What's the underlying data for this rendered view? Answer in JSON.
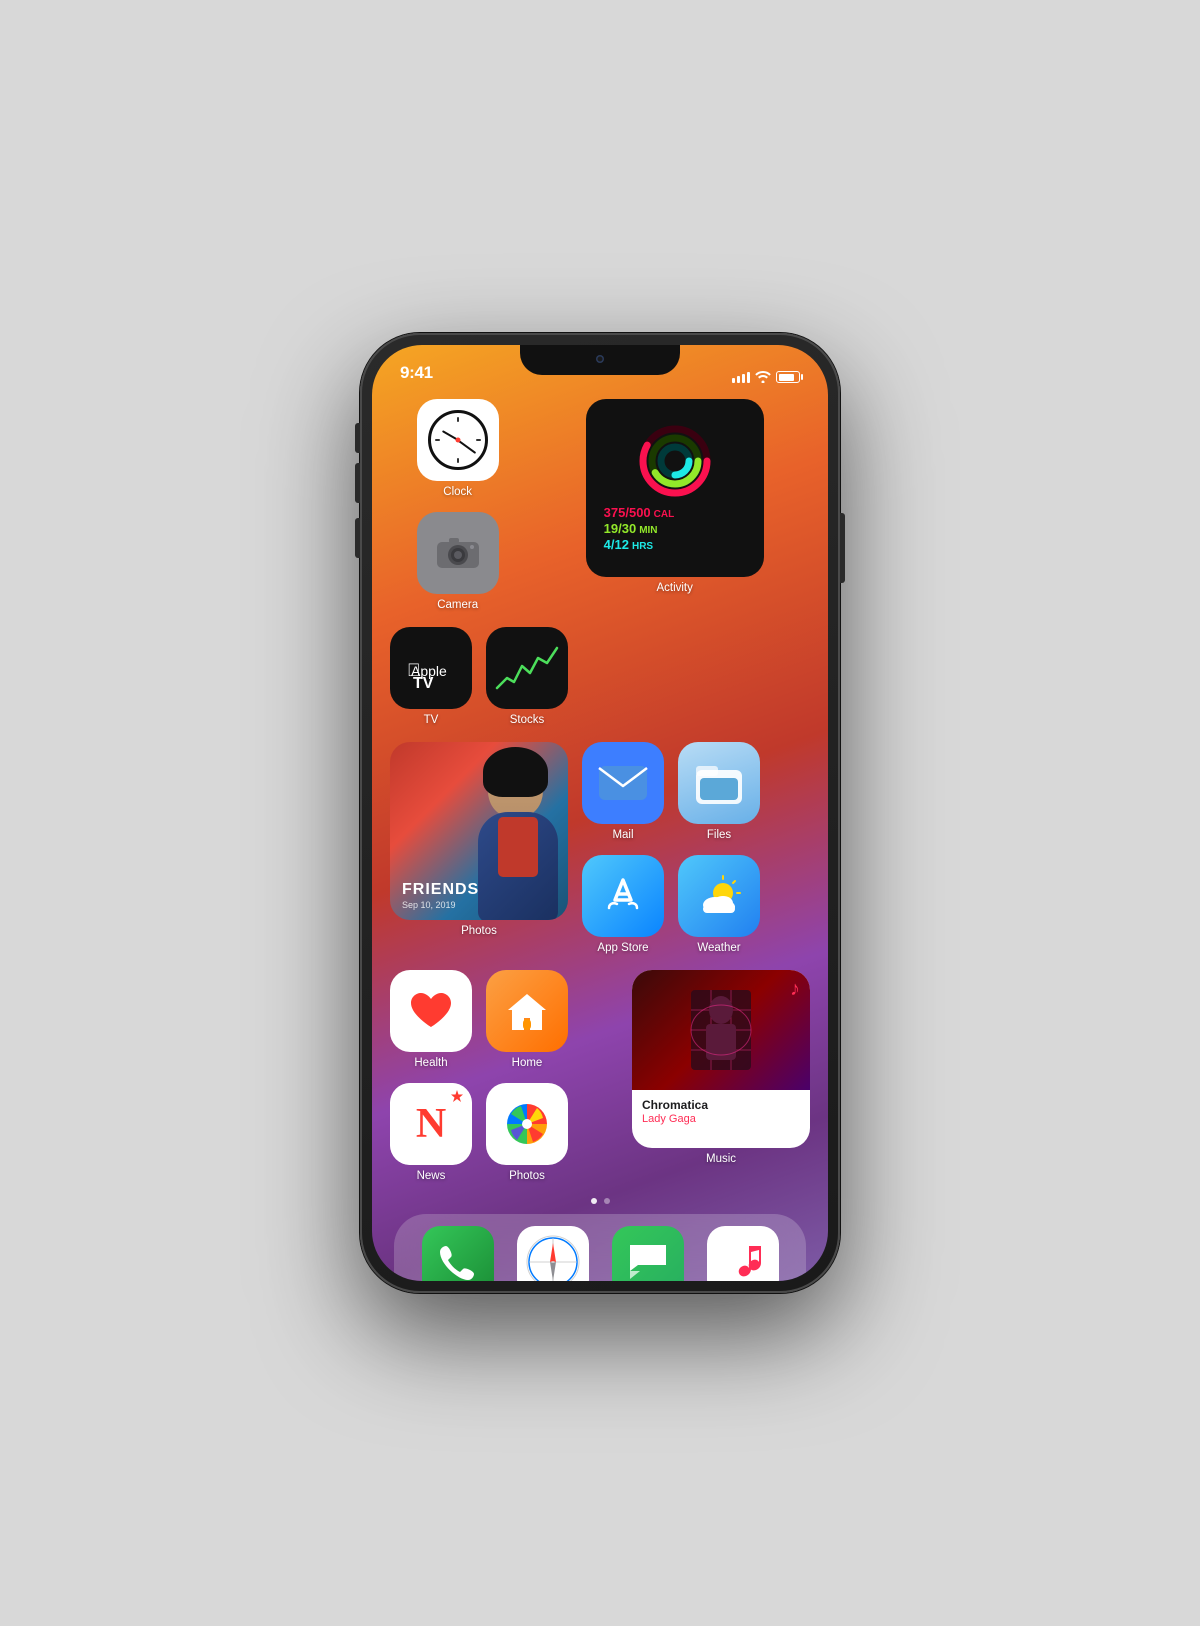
{
  "page": {
    "bg_color": "#d0d0d0"
  },
  "status_bar": {
    "time": "9:41",
    "signal_bars": [
      3,
      5,
      7,
      9,
      11
    ],
    "wifi": "wifi",
    "battery": 80
  },
  "row1": {
    "apps": [
      {
        "id": "clock",
        "label": "Clock"
      },
      {
        "id": "camera",
        "label": "Camera"
      }
    ],
    "widget": {
      "id": "activity",
      "label": "Activity",
      "stats": [
        {
          "value": "375/500",
          "unit": "CAL",
          "color": "#fa114f"
        },
        {
          "value": "19/30",
          "unit": "MIN",
          "color": "#92e82a"
        },
        {
          "value": "4/12",
          "unit": "HRS",
          "color": "#1de9e6"
        }
      ]
    }
  },
  "row2": {
    "apps": [
      {
        "id": "tv",
        "label": "TV"
      },
      {
        "id": "stocks",
        "label": "Stocks"
      }
    ]
  },
  "row3": {
    "widget": {
      "id": "photos-widget",
      "label": "Photos",
      "title": "FRIENDS",
      "date": "Sep 10, 2019"
    },
    "apps": [
      {
        "id": "mail",
        "label": "Mail"
      },
      {
        "id": "files",
        "label": "Files"
      },
      {
        "id": "appstore",
        "label": "App Store"
      },
      {
        "id": "weather",
        "label": "Weather"
      }
    ]
  },
  "row4": {
    "apps": [
      {
        "id": "health",
        "label": "Health"
      },
      {
        "id": "home",
        "label": "Home"
      }
    ],
    "music_widget": {
      "id": "music",
      "label": "Music",
      "album": "Chromatica",
      "artist": "Lady Gaga"
    }
  },
  "row5": {
    "apps": [
      {
        "id": "news",
        "label": "News"
      },
      {
        "id": "photosapp",
        "label": "Photos"
      }
    ]
  },
  "dock": {
    "apps": [
      {
        "id": "phone",
        "label": "Phone"
      },
      {
        "id": "safari",
        "label": "Safari"
      },
      {
        "id": "messages",
        "label": "Messages"
      },
      {
        "id": "music-dock",
        "label": "Music"
      }
    ]
  }
}
